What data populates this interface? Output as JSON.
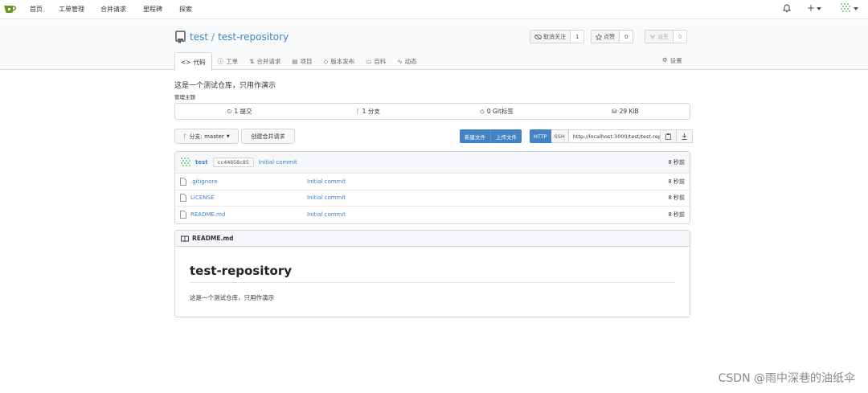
{
  "nav": {
    "items": [
      "首页",
      "工单管理",
      "合并请求",
      "里程碑",
      "探索"
    ],
    "plus": "+"
  },
  "repo": {
    "owner": "test",
    "separator": "/",
    "name": "test-repository",
    "watch_label": "取消关注",
    "watch_count": "1",
    "star_label": "点赞",
    "star_count": "0",
    "fork_label": "派生",
    "fork_count": "0"
  },
  "tabs": [
    {
      "label": "代码",
      "icon": "code-icon"
    },
    {
      "label": "工单",
      "icon": "issue-icon"
    },
    {
      "label": "合并请求",
      "icon": "pull-request-icon"
    },
    {
      "label": "项目",
      "icon": "project-icon"
    },
    {
      "label": "版本发布",
      "icon": "tag-icon"
    },
    {
      "label": "百科",
      "icon": "book-icon"
    },
    {
      "label": "动态",
      "icon": "pulse-icon"
    }
  ],
  "settings_label": "设置",
  "description": "这是一个测试仓库，只用作演示",
  "manage_topics": "管理主题",
  "stats": {
    "commits": "1 提交",
    "branches": "1 分支",
    "tags": "0 Git标签",
    "size": "29 KiB"
  },
  "toolbar": {
    "branch": "分支: master",
    "new_pr": "创建合并请求",
    "new_file": "新建文件",
    "upload_file": "上传文件",
    "http": "HTTP",
    "ssh": "SSH",
    "clone_url": "http://localhost:3000/test/test-repository.git"
  },
  "latest_commit": {
    "author": "test",
    "sha": "cc44858c85",
    "message": "Initial commit",
    "time": "8 秒前"
  },
  "files": [
    {
      "name": ".gitignore",
      "message": "Initial commit",
      "time": "8 秒前"
    },
    {
      "name": "LICENSE",
      "message": "Initial commit",
      "time": "8 秒前"
    },
    {
      "name": "README.md",
      "message": "Initial commit",
      "time": "8 秒前"
    }
  ],
  "readme": {
    "filename": "README.md",
    "heading": "test-repository",
    "body": "这是一个测试仓库，只用作演示"
  },
  "watermark": "CSDN @雨中深巷的油纸伞",
  "colors": {
    "accent": "#4183c4",
    "logo": "#609926"
  }
}
